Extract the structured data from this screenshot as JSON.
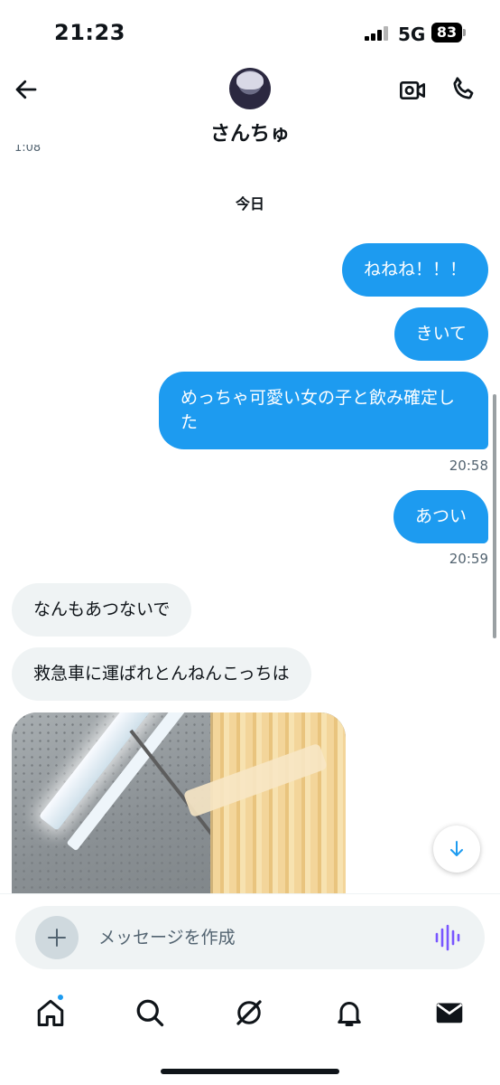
{
  "status_bar": {
    "time": "21:23",
    "network": "5G",
    "battery": "83"
  },
  "header": {
    "contact_name": "さんちゅ"
  },
  "thread": {
    "cut_timestamp": "1:08",
    "date_separator": "今日",
    "messages": [
      {
        "direction": "out",
        "text": "ねねね！！！"
      },
      {
        "direction": "out",
        "text": "きいて"
      },
      {
        "direction": "out",
        "text": "めっちゃ可愛い女の子と飲み確定した",
        "time": "20:58"
      },
      {
        "direction": "out",
        "text": "あつい",
        "time": "20:59"
      },
      {
        "direction": "in",
        "text": "なんもあつないで"
      },
      {
        "direction": "in",
        "text": "救急車に運ばれとんねんこっちは"
      }
    ]
  },
  "composer": {
    "placeholder": "メッセージを作成"
  },
  "colors": {
    "accent": "#1d9bf0",
    "incoming_bubble": "#eff3f4",
    "voice_icon": "#7856ff"
  },
  "icons": [
    "back-arrow-icon",
    "video-camera-icon",
    "phone-icon",
    "arrow-down-icon",
    "plus-icon",
    "voice-waveform-icon",
    "home-icon",
    "search-icon",
    "grok-icon",
    "bell-icon",
    "mail-icon"
  ]
}
